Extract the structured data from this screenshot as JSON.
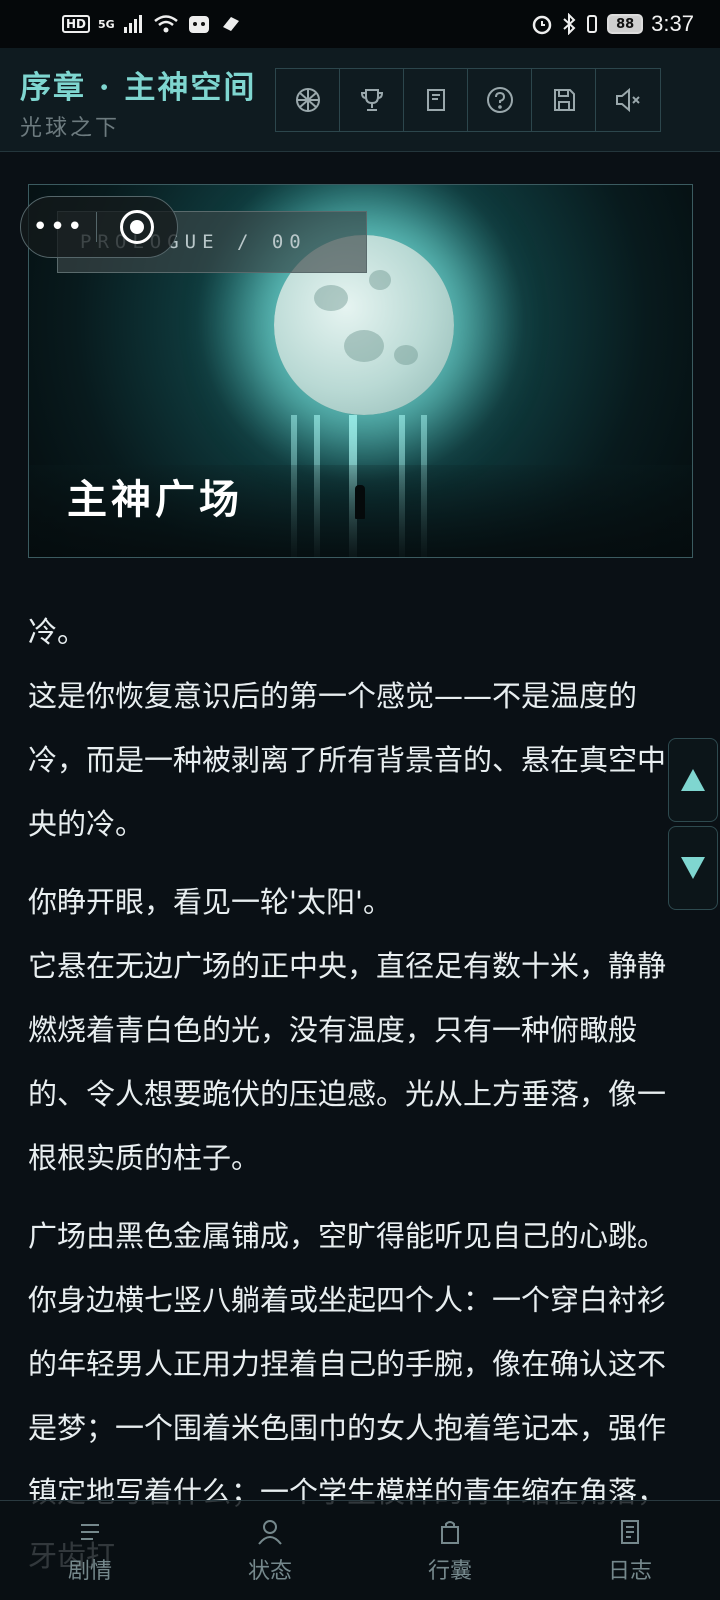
{
  "status_bar": {
    "hd": "HD",
    "network": "5G",
    "battery": "88",
    "time": "3:37"
  },
  "header": {
    "title": "序章 · 主神空间",
    "subtitle": "光球之下",
    "tools": [
      "globe-icon",
      "trophy-icon",
      "notebook-icon",
      "help-icon",
      "save-icon",
      "mute-icon"
    ]
  },
  "hero": {
    "tag": "PROLOGUE / 00",
    "title": "主神广场"
  },
  "story": {
    "paragraphs": [
      "冷。",
      "这是你恢复意识后的第一个感觉——不是温度的冷，而是一种被剥离了所有背景音的、悬在真空中央的冷。",
      "你睁开眼，看见一轮'太阳'。",
      "它悬在无边广场的正中央，直径足有数十米，静静燃烧着青白色的光，没有温度，只有一种俯瞰般的、令人想要跪伏的压迫感。光从上方垂落，像一根根实质的柱子。",
      "广场由黑色金属铺成，空旷得能听见自己的心跳。你身边横七竖八躺着或坐起四个人：一个穿白衬衫的年轻男人正用力捏着自己的手腕，像在确认这不是梦；一个围着米色围巾的女人抱着笔记本，强作镇定地写着什么；一个学生模样的青年缩在角落，牙齿打"
    ]
  },
  "nav": {
    "items": [
      {
        "label": "剧情",
        "icon": "story-icon"
      },
      {
        "label": "状态",
        "icon": "person-icon"
      },
      {
        "label": "行囊",
        "icon": "bag-icon"
      },
      {
        "label": "日志",
        "icon": "log-icon"
      }
    ]
  },
  "colors": {
    "accent": "#7fd6d0",
    "background": "#0a1015"
  }
}
